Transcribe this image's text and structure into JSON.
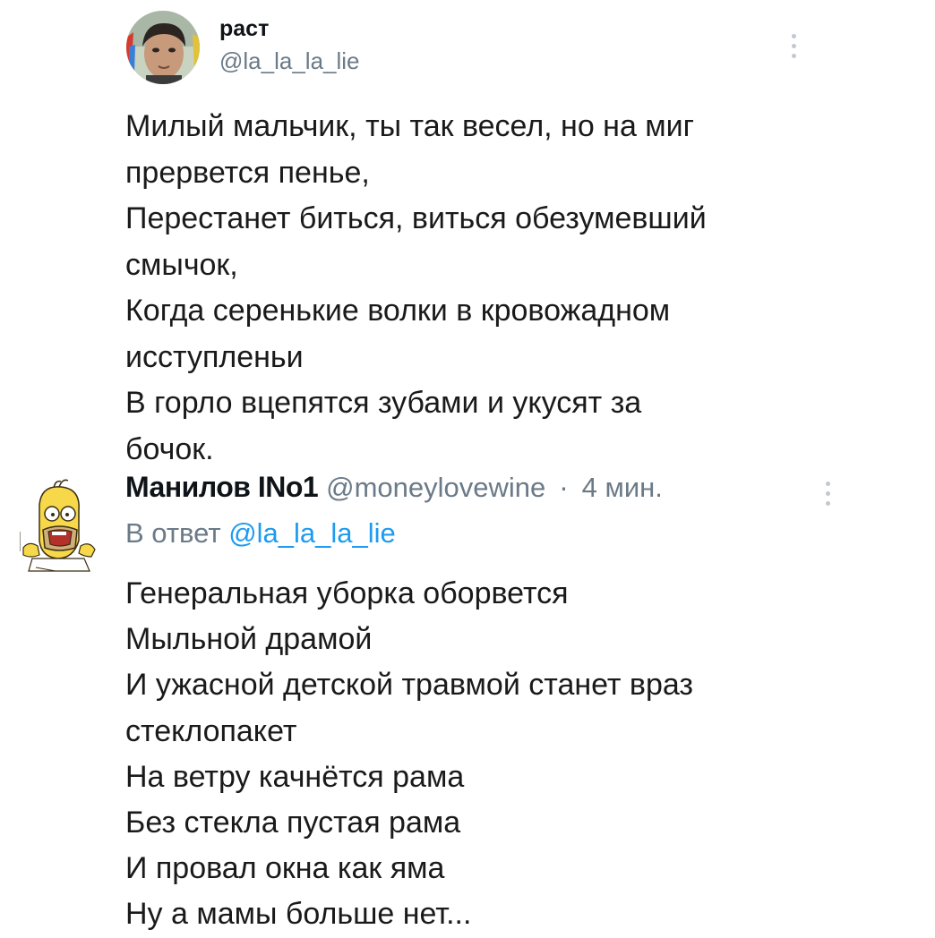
{
  "main_tweet": {
    "display_name": "раст",
    "handle": "@la_la_la_lie",
    "text_lines": [
      "Милый мальчик, ты так весел, но на миг",
      "прервется пенье,",
      "Перестанет биться, виться обезумевший",
      "смычок,",
      "Когда серенькие волки в кровожадном",
      "исступленьи",
      "В горло вцепятся зубами и укусят за",
      "бочок."
    ]
  },
  "reply_tweet": {
    "display_name": "Манилов INo1",
    "handle": "@moneylovewine",
    "separator": "·",
    "time": "4 мин.",
    "replying_to_label": "В ответ",
    "replying_to_handle": "@la_la_la_lie",
    "text_lines": [
      "Генеральная уборка оборвется",
      "Мыльной драмой",
      "И ужасной детской травмой станет враз",
      "стеклопакет",
      "На ветру качнётся рама",
      "Без стекла пустая рама",
      "И провал окна как яма",
      "Ну а мамы больше нет..."
    ]
  },
  "colors": {
    "text": "#0f1419",
    "secondary": "#6b7a88",
    "link": "#1d9bf0",
    "dots": "#c1c8cf"
  },
  "icons": {
    "main_more": "more-vertical-icon",
    "reply_more": "more-vertical-icon"
  }
}
